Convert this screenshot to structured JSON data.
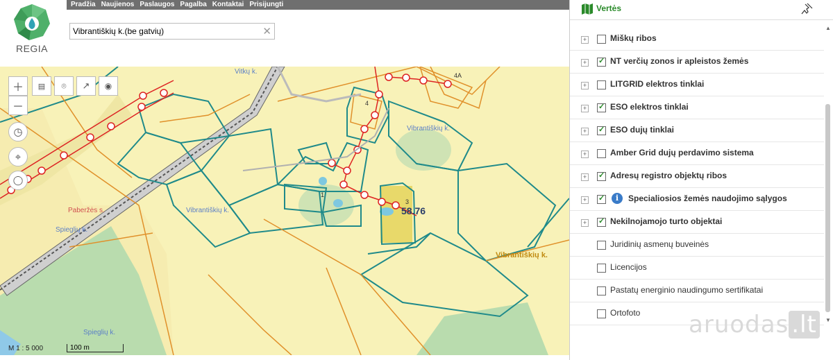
{
  "nav": [
    "Pradžia",
    "Naujienos",
    "Paslaugos",
    "Pagalba",
    "Kontaktai",
    "Prisijungti"
  ],
  "logo_text": "REGIA",
  "search": {
    "value": "Vibrantiškių k.(be gatvių)",
    "clear_icon": "close-icon"
  },
  "map": {
    "scale_text": "M 1 : 5 000",
    "scale_bar_text": "100 m",
    "area_label": "58.76",
    "place_labels": [
      "Vitkų k.",
      "Vibrantiškių k.",
      "Vibrantiškių k.",
      "Paberžės s.",
      "Spieglių k.",
      "Spieglių k.",
      "Vibrantiškių k."
    ],
    "parcel_numbers": [
      "4",
      "4A",
      "1",
      "3"
    ],
    "tools": [
      "zoom-in-icon",
      "zoom-out-icon",
      "measure-icon",
      "marker-icon",
      "export-icon",
      "locate-icon",
      "history-icon",
      "crosshair-icon",
      "lasso-icon"
    ]
  },
  "panel": {
    "title": "Vertės",
    "layers": [
      {
        "label": "Miškų ribos",
        "checked": false,
        "expand": true
      },
      {
        "label": "NT verčių zonos ir apleistos žemės",
        "checked": true,
        "expand": true
      },
      {
        "label": "LITGRID elektros tinklai",
        "checked": false,
        "expand": true
      },
      {
        "label": "ESO elektros tinklai",
        "checked": true,
        "expand": true
      },
      {
        "label": "ESO dujų tinklai",
        "checked": true,
        "expand": true
      },
      {
        "label": "Amber Grid dujų perdavimo sistema",
        "checked": false,
        "expand": true
      },
      {
        "label": "Adresų registro objektų ribos",
        "checked": true,
        "expand": true
      },
      {
        "label": "Specialiosios žemės naudojimo sąlygos",
        "checked": true,
        "expand": true,
        "info": true
      },
      {
        "label": "Nekilnojamojo turto objektai",
        "checked": true,
        "expand": true
      },
      {
        "label": "Juridinių asmenų buveinės",
        "checked": false,
        "expand": false
      },
      {
        "label": "Licencijos",
        "checked": false,
        "expand": false
      },
      {
        "label": "Pastatų energinio naudingumo sertifikatai",
        "checked": false,
        "expand": false
      },
      {
        "label": "Ortofoto",
        "checked": false,
        "expand": false
      }
    ]
  },
  "watermark": {
    "text": "aruodas",
    "suffix": ".lt"
  },
  "colors": {
    "map_bg": "#f8f2b8",
    "parcel_line": "#1f8a8a",
    "boundary_line": "#e0902a",
    "power_line": "#d22",
    "forest": "#b9dcae",
    "accent": "#2a8a2a"
  }
}
